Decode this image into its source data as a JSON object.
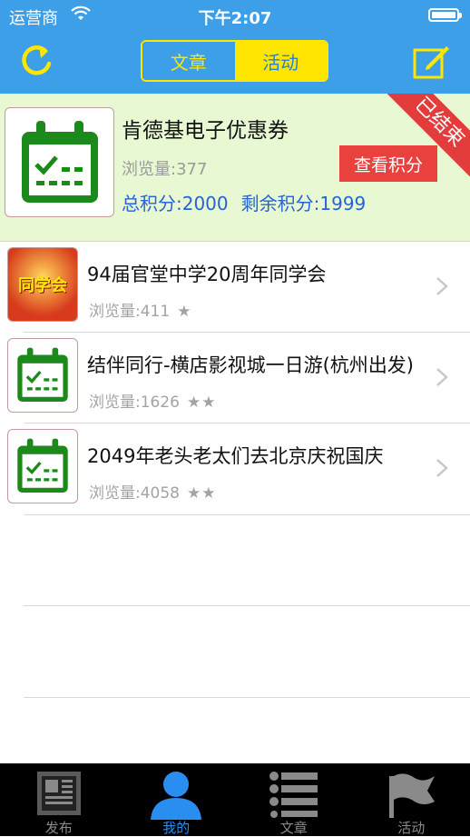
{
  "status": {
    "carrier": "运营商",
    "time": "下午2:07",
    "battery_level": 1.0
  },
  "nav": {
    "tabs": [
      "文章",
      "活动"
    ],
    "active_tab": "活动"
  },
  "featured": {
    "title": "肯德基电子优惠券",
    "views": "浏览量:377",
    "total": "总积分:2000",
    "remaining": "剩余积分:1999",
    "view_button": "查看积分",
    "ribbon": "已结束"
  },
  "items": [
    {
      "title": "94届官堂中学20周年同学会",
      "views": "浏览量:411",
      "stars": "★",
      "thumb": "poster",
      "poster_text": "同学会"
    },
    {
      "title": "结伴同行-横店影视城一日游(杭州出发)",
      "views": "浏览量:1626",
      "stars": "★★",
      "thumb": "calendar"
    },
    {
      "title": "2049年老头老太们去北京庆祝国庆",
      "views": "浏览量:4058",
      "stars": "★★",
      "thumb": "calendar"
    }
  ],
  "tabbar": {
    "items": [
      "发布",
      "我的",
      "文章",
      "活动"
    ],
    "active": "我的"
  },
  "colors": {
    "nav_bg": "#3d9fe8",
    "accent_yellow": "#ffe600",
    "feature_bg": "#e8f8d2",
    "button_red": "#e8413e",
    "link_blue": "#2563d6",
    "tab_active": "#2a8df0"
  }
}
